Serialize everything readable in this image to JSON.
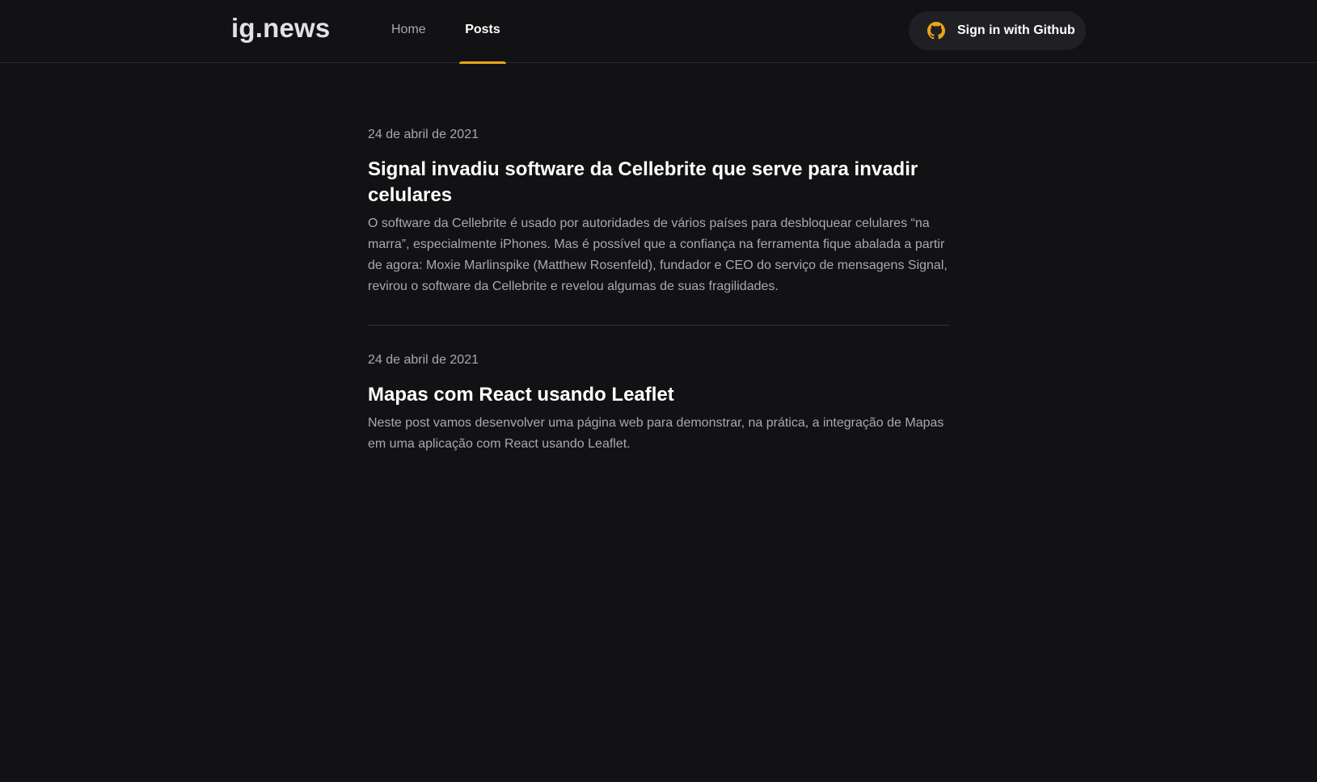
{
  "header": {
    "logo": "ig.news",
    "nav": [
      {
        "label": "Home",
        "active": false
      },
      {
        "label": "Posts",
        "active": true
      }
    ],
    "signin_label": "Sign in with Github",
    "signin_icon": "github-icon"
  },
  "posts": [
    {
      "date": "24 de abril de 2021",
      "title": "Signal invadiu software da Cellebrite que serve para invadir celulares",
      "excerpt": "O software da Cellebrite é usado por autoridades de vários países para desbloquear celulares “na marra”, especialmente iPhones. Mas é possível que a confiança na ferramenta fique abalada a partir de agora: Moxie Marlinspike (Matthew Rosenfeld), fundador e CEO do serviço de mensagens Signal, revirou o software da Cellebrite e revelou algumas de suas fragilidades."
    },
    {
      "date": "24 de abril de 2021",
      "title": "Mapas com React usando Leaflet",
      "excerpt": "Neste post vamos desenvolver uma página web para demonstrar, na prática, a integração de Mapas em uma aplicação com React usando Leaflet."
    }
  ],
  "colors": {
    "background": "#121214",
    "accent": "#eba417",
    "text_primary": "#ffffff",
    "text_muted": "#a8a8b3",
    "button_bg": "#202024"
  }
}
